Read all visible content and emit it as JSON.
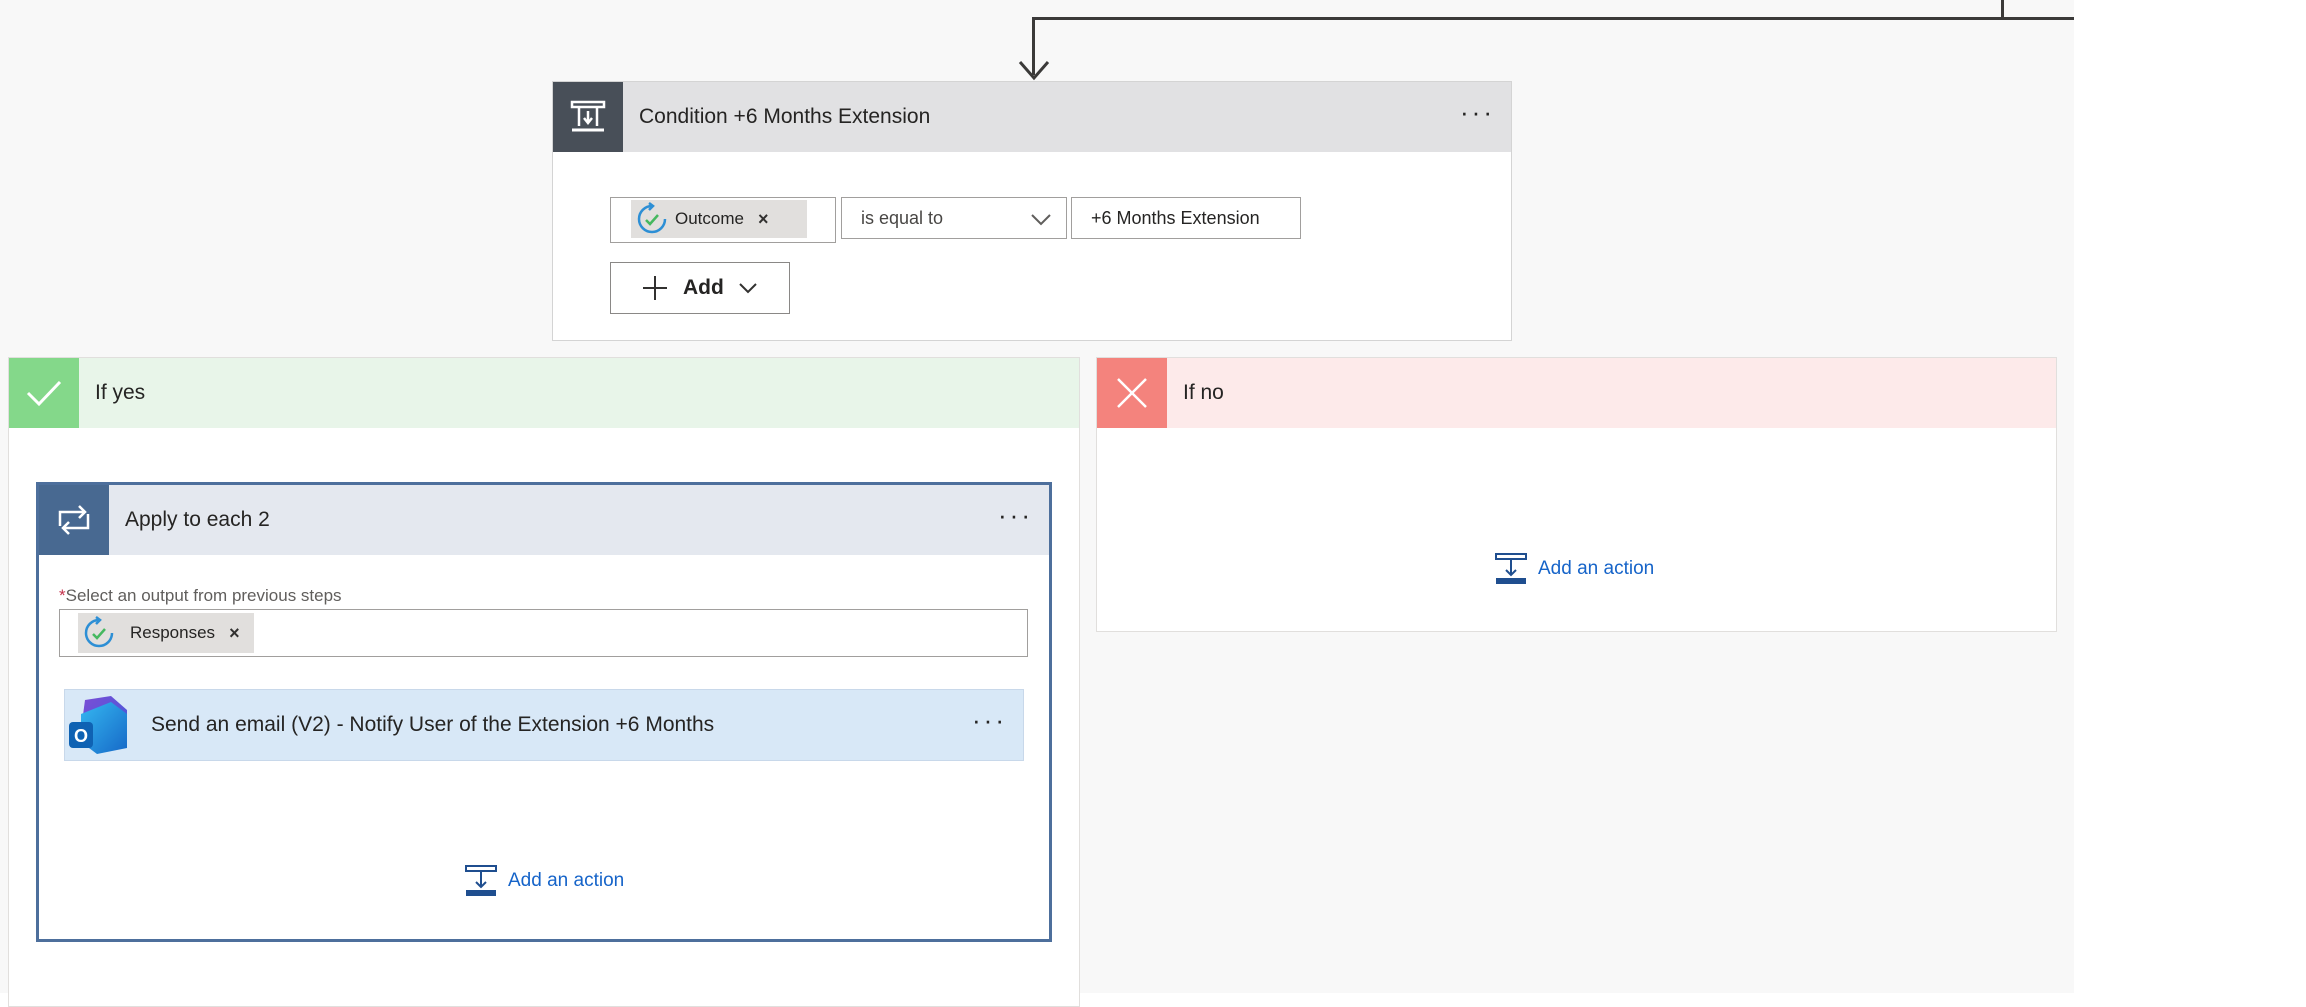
{
  "colors": {
    "canvas_bg": "#f8f8f8",
    "condition_icon_bg": "#484f58",
    "condition_header_bg": "#e1e1e3",
    "yes_icon_bg": "#84d88a",
    "yes_header_bg": "#e8f5e9",
    "no_icon_bg": "#f4837d",
    "no_header_bg": "#fdeaea",
    "loop_icon_bg": "#486991",
    "loop_header_bg": "#e4e8ef",
    "loop_border": "#4d6f9c",
    "email_header_bg": "#d8e8f7",
    "link": "#1664c9",
    "required": "#c4314b"
  },
  "condition": {
    "title": "Condition +6 Months Extension",
    "icon": "condition-icon",
    "more": "···",
    "left_token": {
      "label": "Outcome",
      "icon": "approvals-icon",
      "remove": "×"
    },
    "operator": "is equal to",
    "right_value": "+6 Months Extension",
    "add_button": "Add"
  },
  "yes_branch": {
    "title": "If yes",
    "icon": "check-icon",
    "loop": {
      "title": "Apply to each 2",
      "icon": "loop-icon",
      "more": "···",
      "required_mark": "*",
      "field_label": "Select an output from previous steps",
      "token": {
        "label": "Responses",
        "icon": "approvals-icon",
        "remove": "×"
      },
      "email_action": {
        "title": "Send an email (V2) - Notify User of the Extension +6 Months",
        "icon": "outlook-icon",
        "more": "···"
      },
      "add_action": "Add an action"
    }
  },
  "no_branch": {
    "title": "If no",
    "icon": "close-icon",
    "add_action": "Add an action"
  }
}
